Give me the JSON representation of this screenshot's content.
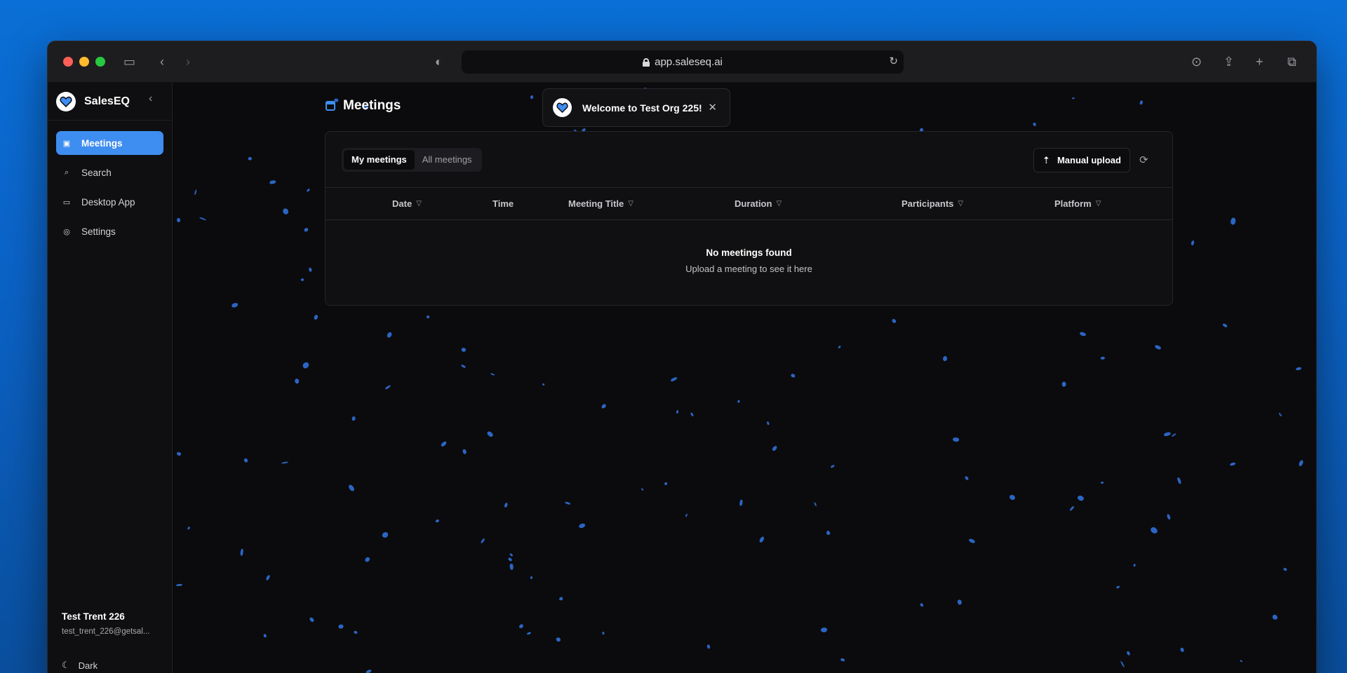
{
  "browser": {
    "url": "app.saleseq.ai",
    "traffic_lights": [
      "#ff5f57",
      "#febc2e",
      "#28c840"
    ]
  },
  "sidebar": {
    "app_name": "SalesEQ",
    "items": [
      {
        "label": "Meetings",
        "icon": "calendar-icon",
        "active": true
      },
      {
        "label": "Search",
        "icon": "search-icon",
        "active": false
      },
      {
        "label": "Desktop App",
        "icon": "monitor-icon",
        "active": false
      },
      {
        "label": "Settings",
        "icon": "gear-icon",
        "active": false
      }
    ],
    "user": {
      "name": "Test Trent 226",
      "email": "test_trent_226@getsal..."
    },
    "theme_label": "Dark"
  },
  "page": {
    "title": "Meetings"
  },
  "toast": {
    "message": "Welcome to Test Org 225!"
  },
  "meetings": {
    "tabs": [
      {
        "label": "My meetings",
        "active": true
      },
      {
        "label": "All meetings",
        "active": false
      }
    ],
    "upload_label": "Manual upload",
    "columns": [
      "Date",
      "Time",
      "Meeting Title",
      "Duration",
      "Participants",
      "Platform"
    ],
    "empty_title": "No meetings found",
    "empty_subtitle": "Upload a meeting to see it here"
  },
  "colors": {
    "accent": "#3e8df0",
    "background": "#0b0b0d",
    "confetti": "#2f6fd8"
  }
}
